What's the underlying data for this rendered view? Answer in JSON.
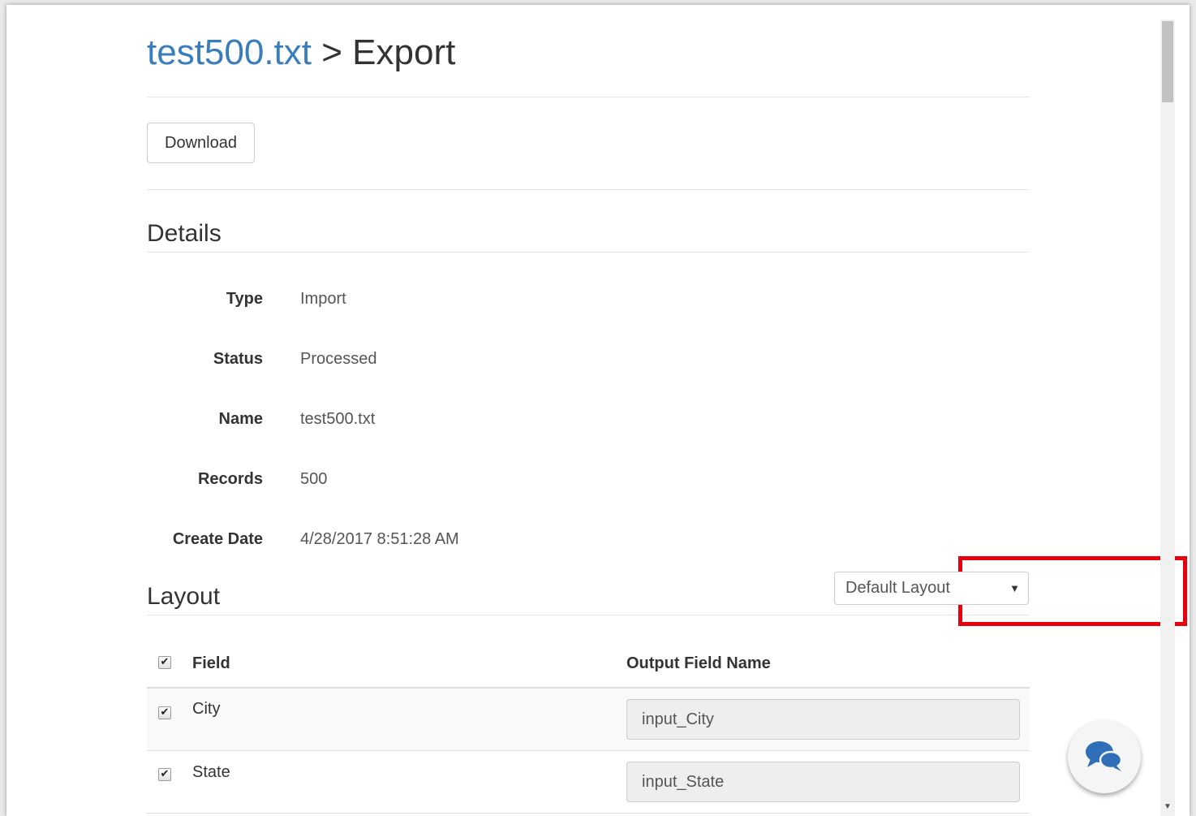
{
  "header": {
    "file_link": "test500.txt",
    "separator": " > ",
    "page": "Export"
  },
  "toolbar": {
    "download_label": "Download"
  },
  "details": {
    "title": "Details",
    "rows": [
      {
        "label": "Type",
        "value": "Import"
      },
      {
        "label": "Status",
        "value": "Processed"
      },
      {
        "label": "Name",
        "value": "test500.txt"
      },
      {
        "label": "Records",
        "value": "500"
      },
      {
        "label": "Create Date",
        "value": "4/28/2017 8:51:28 AM"
      }
    ]
  },
  "layout": {
    "title": "Layout",
    "select_value": "Default Layout",
    "highlight_color": "#e8000d"
  },
  "table": {
    "columns": {
      "field": "Field",
      "output": "Output Field Name"
    },
    "rows": [
      {
        "field": "City",
        "output": "input_City",
        "checked": true
      },
      {
        "field": "State",
        "output": "input_State",
        "checked": true
      }
    ]
  },
  "colors": {
    "link": "#3a7dbd",
    "text": "#333333"
  },
  "icons": {
    "chat": "chat-bubbles-icon",
    "dropdown": "caret-down-icon",
    "check": "checkmark-icon"
  }
}
